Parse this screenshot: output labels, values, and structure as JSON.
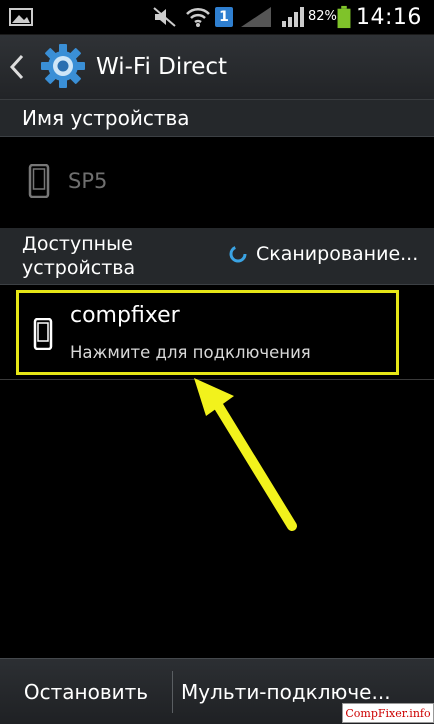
{
  "status_bar": {
    "notification_badge": "1",
    "battery_percent": "82%",
    "time": "14:16",
    "icons": [
      "image-icon",
      "mute-icon",
      "wifi-icon",
      "sim1-icon",
      "no-signal-icon",
      "signal-icon",
      "battery-icon"
    ]
  },
  "action_bar": {
    "title": "Wi-Fi Direct",
    "icons": [
      "back-icon",
      "gear-icon"
    ]
  },
  "device_section": {
    "header": "Имя устройства",
    "device_name": "SP5"
  },
  "available_section": {
    "header": "Доступные устройства",
    "scan_status": "Сканирование..."
  },
  "peers": [
    {
      "name": "compfixer",
      "status": "Нажмите для подключения"
    }
  ],
  "bottom_bar": {
    "stop_label": "Остановить",
    "multi_label": "Мульти-подключе..."
  },
  "watermark": "CompFixer.info",
  "colors": {
    "background": "#000000",
    "header_bg": "#25282b",
    "highlight": "#e6e617",
    "accent": "#3aa3e3"
  }
}
